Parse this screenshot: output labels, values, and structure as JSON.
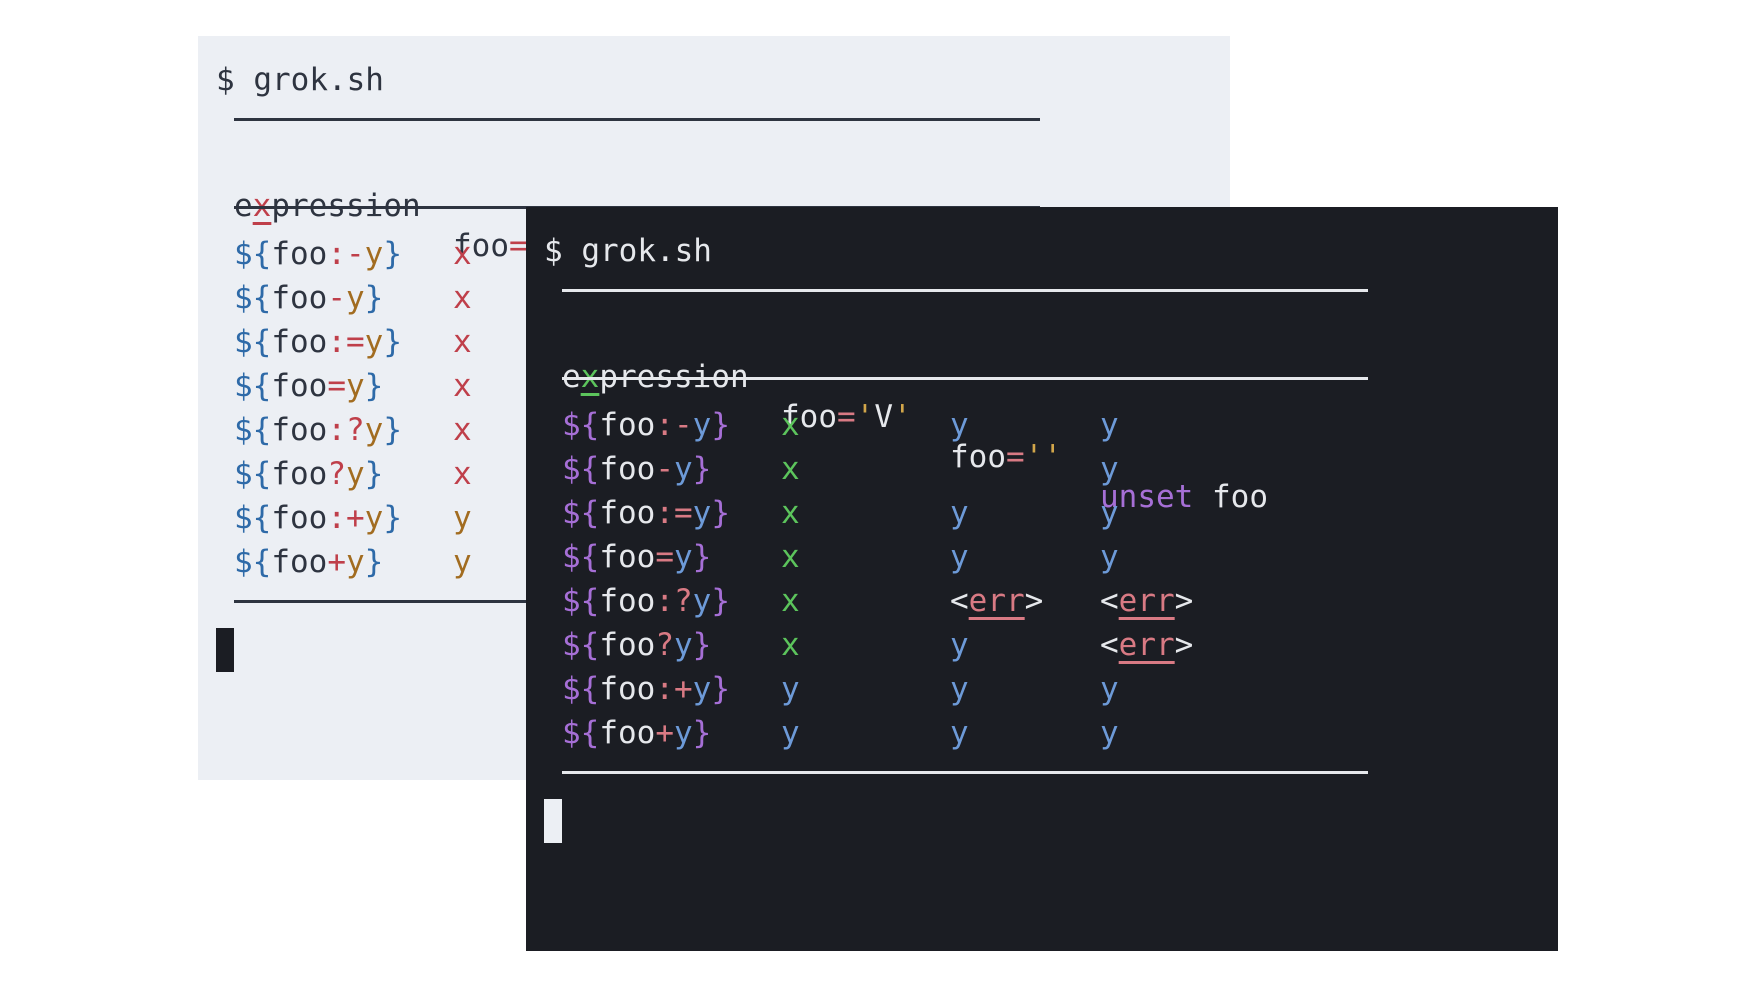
{
  "prompt": "$ grok.sh",
  "header": {
    "expr_pre": "e",
    "expr_x": "x",
    "expr_post": "pression",
    "foo_v_name": "foo",
    "foo_v_eq": "=",
    "foo_v_q1": "'",
    "foo_v_val": "V",
    "foo_v_q2": "'",
    "foo_e_name": "foo",
    "foo_e_eq": "=",
    "foo_e_quotes": "''",
    "unset_kw": "unset",
    "unset_name": " foo"
  },
  "rows": [
    {
      "open": "${",
      "name": "foo",
      "op": ":-",
      "y": "y",
      "close": "}",
      "v": "x",
      "e": "y",
      "u": "y"
    },
    {
      "open": "${",
      "name": "foo",
      "op": "-",
      "y": "y",
      "close": "}",
      "v": "x",
      "e": "",
      "u": "y"
    },
    {
      "open": "${",
      "name": "foo",
      "op": ":=",
      "y": "y",
      "close": "}",
      "v": "x",
      "e": "y",
      "u": "y"
    },
    {
      "open": "${",
      "name": "foo",
      "op": "=",
      "y": "y",
      "close": "}",
      "v": "x",
      "e": "y",
      "u": "y"
    },
    {
      "open": "${",
      "name": "foo",
      "op": ":?",
      "y": "y",
      "close": "}",
      "v": "x",
      "e_err": "err",
      "u_err": "err"
    },
    {
      "open": "${",
      "name": "foo",
      "op": "?",
      "y": "y",
      "close": "}",
      "v": "x",
      "e": "y",
      "u_err": "err"
    },
    {
      "open": "${",
      "name": "foo",
      "op": ":+",
      "y": "y",
      "close": "}",
      "v": "y",
      "e": "y",
      "u": "y"
    },
    {
      "open": "${",
      "name": "foo",
      "op": "+",
      "y": "y",
      "close": "}",
      "v": "y",
      "e": "y",
      "u": "y"
    }
  ],
  "err_lt": "<",
  "err_gt": ">"
}
